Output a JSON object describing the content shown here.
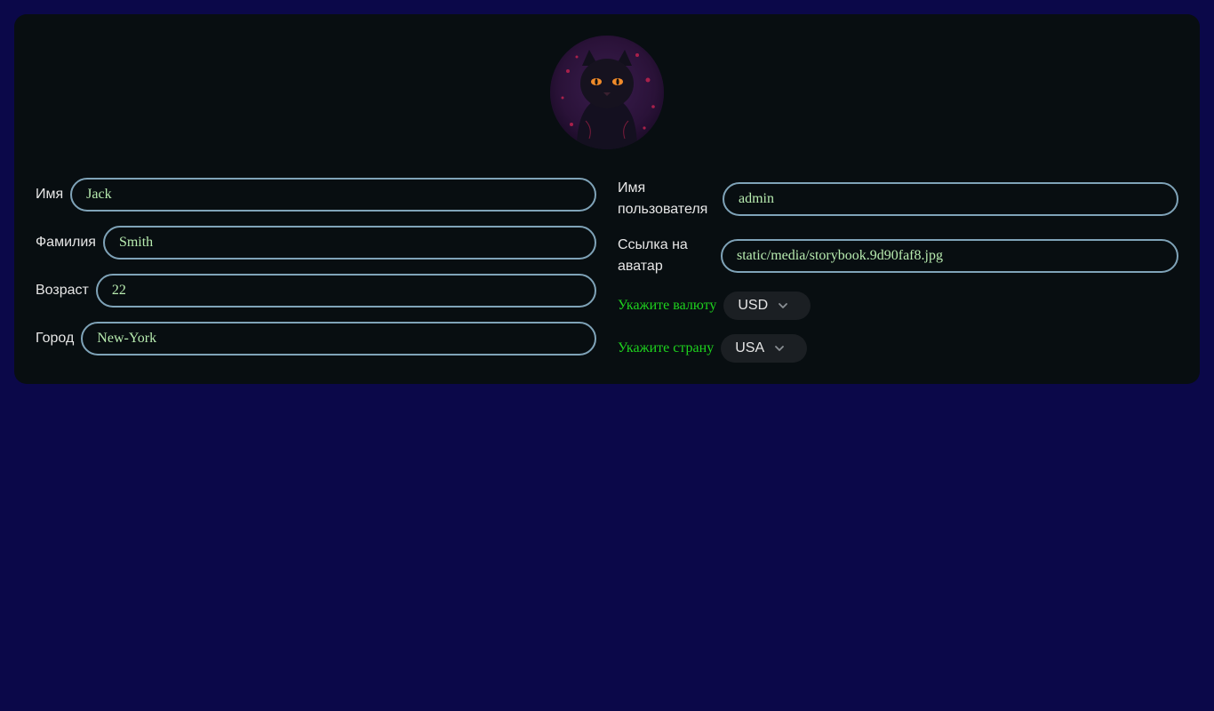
{
  "profile": {
    "avatar_icon": "black-cat-avatar",
    "first_name": {
      "label": "Имя",
      "value": "Jack"
    },
    "last_name": {
      "label": "Фамилия",
      "value": "Smith"
    },
    "age": {
      "label": "Возраст",
      "value": "22"
    },
    "city": {
      "label": "Город",
      "value": "New-York"
    },
    "username": {
      "label_line1": "Имя",
      "label_line2": "пользователя",
      "value": "admin"
    },
    "avatar_link": {
      "label_line1": "Ссылка на",
      "label_line2": "аватар",
      "value": "static/media/storybook.9d90faf8.jpg"
    },
    "currency": {
      "label": "Укажите валюту",
      "value": "USD"
    },
    "country": {
      "label": "Укажите страну",
      "value": "USA"
    }
  },
  "colors": {
    "page_bg": "#0b0849",
    "card_bg": "#080e11",
    "input_border": "#7fa3b8",
    "input_text": "#b8ecb0",
    "accent_green": "#1ed31e"
  }
}
